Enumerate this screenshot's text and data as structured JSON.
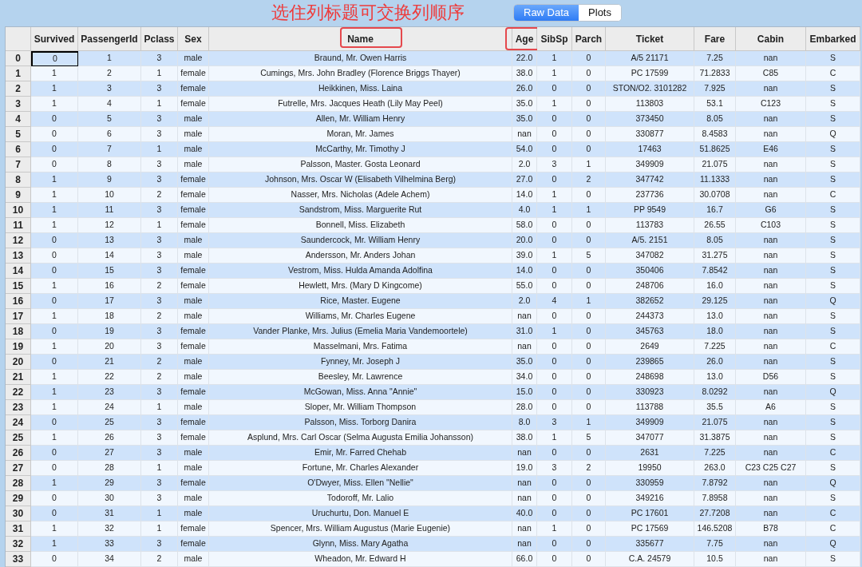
{
  "tabs": [
    {
      "label": "Raw Data",
      "selected": true
    },
    {
      "label": "Plots",
      "selected": false
    }
  ],
  "table": {
    "columns": [
      {
        "label": "Survived",
        "highlighted": false
      },
      {
        "label": "PassengerId",
        "highlighted": false
      },
      {
        "label": "Pclass",
        "highlighted": false
      },
      {
        "label": "Sex",
        "highlighted": false
      },
      {
        "label": "Name",
        "highlighted": true
      },
      {
        "label": "Age",
        "highlighted": true
      },
      {
        "label": "SibSp",
        "highlighted": false
      },
      {
        "label": "Parch",
        "highlighted": false
      },
      {
        "label": "Ticket",
        "highlighted": false
      },
      {
        "label": "Fare",
        "highlighted": false
      },
      {
        "label": "Cabin",
        "highlighted": false
      },
      {
        "label": "Embarked",
        "highlighted": false
      }
    ],
    "rows": [
      {
        "index": "0",
        "current": true,
        "cells": [
          "0",
          "1",
          "3",
          "male",
          "Braund, Mr. Owen Harris",
          "22.0",
          "1",
          "0",
          "A/5 21171",
          "7.25",
          "nan",
          "S"
        ]
      },
      {
        "index": "1",
        "current": false,
        "cells": [
          "1",
          "2",
          "1",
          "female",
          "Cumings, Mrs. John Bradley (Florence Briggs Thayer)",
          "38.0",
          "1",
          "0",
          "PC 17599",
          "71.2833",
          "C85",
          "C"
        ]
      },
      {
        "index": "2",
        "current": false,
        "cells": [
          "1",
          "3",
          "3",
          "female",
          "Heikkinen, Miss. Laina",
          "26.0",
          "0",
          "0",
          "STON/O2. 3101282",
          "7.925",
          "nan",
          "S"
        ]
      },
      {
        "index": "3",
        "current": false,
        "cells": [
          "1",
          "4",
          "1",
          "female",
          "Futrelle, Mrs. Jacques Heath (Lily May Peel)",
          "35.0",
          "1",
          "0",
          "113803",
          "53.1",
          "C123",
          "S"
        ]
      },
      {
        "index": "4",
        "current": false,
        "cells": [
          "0",
          "5",
          "3",
          "male",
          "Allen, Mr. William Henry",
          "35.0",
          "0",
          "0",
          "373450",
          "8.05",
          "nan",
          "S"
        ]
      },
      {
        "index": "5",
        "current": false,
        "cells": [
          "0",
          "6",
          "3",
          "male",
          "Moran, Mr. James",
          "nan",
          "0",
          "0",
          "330877",
          "8.4583",
          "nan",
          "Q"
        ]
      },
      {
        "index": "6",
        "current": false,
        "cells": [
          "0",
          "7",
          "1",
          "male",
          "McCarthy, Mr. Timothy J",
          "54.0",
          "0",
          "0",
          "17463",
          "51.8625",
          "E46",
          "S"
        ]
      },
      {
        "index": "7",
        "current": false,
        "cells": [
          "0",
          "8",
          "3",
          "male",
          "Palsson, Master. Gosta Leonard",
          "2.0",
          "3",
          "1",
          "349909",
          "21.075",
          "nan",
          "S"
        ]
      },
      {
        "index": "8",
        "current": false,
        "cells": [
          "1",
          "9",
          "3",
          "female",
          "Johnson, Mrs. Oscar W (Elisabeth Vilhelmina Berg)",
          "27.0",
          "0",
          "2",
          "347742",
          "11.1333",
          "nan",
          "S"
        ]
      },
      {
        "index": "9",
        "current": false,
        "cells": [
          "1",
          "10",
          "2",
          "female",
          "Nasser, Mrs. Nicholas (Adele Achem)",
          "14.0",
          "1",
          "0",
          "237736",
          "30.0708",
          "nan",
          "C"
        ]
      },
      {
        "index": "10",
        "current": false,
        "cells": [
          "1",
          "11",
          "3",
          "female",
          "Sandstrom, Miss. Marguerite Rut",
          "4.0",
          "1",
          "1",
          "PP 9549",
          "16.7",
          "G6",
          "S"
        ]
      },
      {
        "index": "11",
        "current": false,
        "cells": [
          "1",
          "12",
          "1",
          "female",
          "Bonnell, Miss. Elizabeth",
          "58.0",
          "0",
          "0",
          "113783",
          "26.55",
          "C103",
          "S"
        ]
      },
      {
        "index": "12",
        "current": false,
        "cells": [
          "0",
          "13",
          "3",
          "male",
          "Saundercock, Mr. William Henry",
          "20.0",
          "0",
          "0",
          "A/5. 2151",
          "8.05",
          "nan",
          "S"
        ]
      },
      {
        "index": "13",
        "current": false,
        "cells": [
          "0",
          "14",
          "3",
          "male",
          "Andersson, Mr. Anders Johan",
          "39.0",
          "1",
          "5",
          "347082",
          "31.275",
          "nan",
          "S"
        ]
      },
      {
        "index": "14",
        "current": false,
        "cells": [
          "0",
          "15",
          "3",
          "female",
          "Vestrom, Miss. Hulda Amanda Adolfina",
          "14.0",
          "0",
          "0",
          "350406",
          "7.8542",
          "nan",
          "S"
        ]
      },
      {
        "index": "15",
        "current": false,
        "cells": [
          "1",
          "16",
          "2",
          "female",
          "Hewlett, Mrs. (Mary D Kingcome)",
          "55.0",
          "0",
          "0",
          "248706",
          "16.0",
          "nan",
          "S"
        ]
      },
      {
        "index": "16",
        "current": false,
        "cells": [
          "0",
          "17",
          "3",
          "male",
          "Rice, Master. Eugene",
          "2.0",
          "4",
          "1",
          "382652",
          "29.125",
          "nan",
          "Q"
        ]
      },
      {
        "index": "17",
        "current": false,
        "cells": [
          "1",
          "18",
          "2",
          "male",
          "Williams, Mr. Charles Eugene",
          "nan",
          "0",
          "0",
          "244373",
          "13.0",
          "nan",
          "S"
        ]
      },
      {
        "index": "18",
        "current": false,
        "cells": [
          "0",
          "19",
          "3",
          "female",
          "Vander Planke, Mrs. Julius (Emelia Maria Vandemoortele)",
          "31.0",
          "1",
          "0",
          "345763",
          "18.0",
          "nan",
          "S"
        ]
      },
      {
        "index": "19",
        "current": false,
        "cells": [
          "1",
          "20",
          "3",
          "female",
          "Masselmani, Mrs. Fatima",
          "nan",
          "0",
          "0",
          "2649",
          "7.225",
          "nan",
          "C"
        ]
      },
      {
        "index": "20",
        "current": false,
        "cells": [
          "0",
          "21",
          "2",
          "male",
          "Fynney, Mr. Joseph J",
          "35.0",
          "0",
          "0",
          "239865",
          "26.0",
          "nan",
          "S"
        ]
      },
      {
        "index": "21",
        "current": false,
        "cells": [
          "1",
          "22",
          "2",
          "male",
          "Beesley, Mr. Lawrence",
          "34.0",
          "0",
          "0",
          "248698",
          "13.0",
          "D56",
          "S"
        ]
      },
      {
        "index": "22",
        "current": false,
        "cells": [
          "1",
          "23",
          "3",
          "female",
          "McGowan, Miss. Anna \"Annie\"",
          "15.0",
          "0",
          "0",
          "330923",
          "8.0292",
          "nan",
          "Q"
        ]
      },
      {
        "index": "23",
        "current": false,
        "cells": [
          "1",
          "24",
          "1",
          "male",
          "Sloper, Mr. William Thompson",
          "28.0",
          "0",
          "0",
          "113788",
          "35.5",
          "A6",
          "S"
        ]
      },
      {
        "index": "24",
        "current": false,
        "cells": [
          "0",
          "25",
          "3",
          "female",
          "Palsson, Miss. Torborg Danira",
          "8.0",
          "3",
          "1",
          "349909",
          "21.075",
          "nan",
          "S"
        ]
      },
      {
        "index": "25",
        "current": false,
        "cells": [
          "1",
          "26",
          "3",
          "female",
          "Asplund, Mrs. Carl Oscar (Selma Augusta Emilia Johansson)",
          "38.0",
          "1",
          "5",
          "347077",
          "31.3875",
          "nan",
          "S"
        ]
      },
      {
        "index": "26",
        "current": false,
        "cells": [
          "0",
          "27",
          "3",
          "male",
          "Emir, Mr. Farred Chehab",
          "nan",
          "0",
          "0",
          "2631",
          "7.225",
          "nan",
          "C"
        ]
      },
      {
        "index": "27",
        "current": false,
        "cells": [
          "0",
          "28",
          "1",
          "male",
          "Fortune, Mr. Charles Alexander",
          "19.0",
          "3",
          "2",
          "19950",
          "263.0",
          "C23 C25 C27",
          "S"
        ]
      },
      {
        "index": "28",
        "current": false,
        "cells": [
          "1",
          "29",
          "3",
          "female",
          "O'Dwyer, Miss. Ellen \"Nellie\"",
          "nan",
          "0",
          "0",
          "330959",
          "7.8792",
          "nan",
          "Q"
        ]
      },
      {
        "index": "29",
        "current": false,
        "cells": [
          "0",
          "30",
          "3",
          "male",
          "Todoroff, Mr. Lalio",
          "nan",
          "0",
          "0",
          "349216",
          "7.8958",
          "nan",
          "S"
        ]
      },
      {
        "index": "30",
        "current": false,
        "cells": [
          "0",
          "31",
          "1",
          "male",
          "Uruchurtu, Don. Manuel E",
          "40.0",
          "0",
          "0",
          "PC 17601",
          "27.7208",
          "nan",
          "C"
        ]
      },
      {
        "index": "31",
        "current": false,
        "cells": [
          "1",
          "32",
          "1",
          "female",
          "Spencer, Mrs. William Augustus (Marie Eugenie)",
          "nan",
          "1",
          "0",
          "PC 17569",
          "146.5208",
          "B78",
          "C"
        ]
      },
      {
        "index": "32",
        "current": false,
        "cells": [
          "1",
          "33",
          "3",
          "female",
          "Glynn, Miss. Mary Agatha",
          "nan",
          "0",
          "0",
          "335677",
          "7.75",
          "nan",
          "Q"
        ]
      },
      {
        "index": "33",
        "current": false,
        "cells": [
          "0",
          "34",
          "2",
          "male",
          "Wheadon, Mr. Edward H",
          "66.0",
          "0",
          "0",
          "C.A. 24579",
          "10.5",
          "nan",
          "S"
        ]
      }
    ]
  },
  "annotation_note": "选住列标题可交换列顺序"
}
